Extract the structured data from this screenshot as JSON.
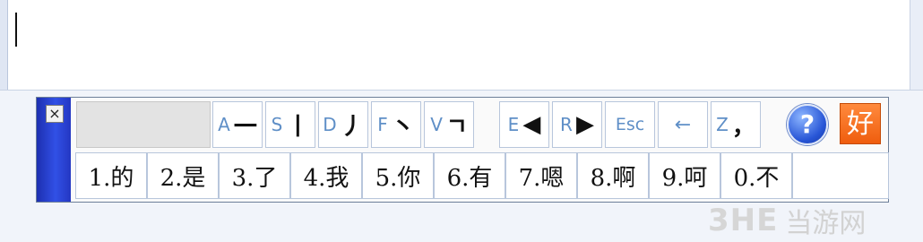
{
  "toolbar": {
    "close_label": "×",
    "pinyin_input": "",
    "keys": [
      {
        "letter": "A",
        "glyph": "一",
        "name": "stroke-key-horizontal"
      },
      {
        "letter": "S",
        "glyph": "丨",
        "name": "stroke-key-vertical"
      },
      {
        "letter": "D",
        "glyph": "丿",
        "name": "stroke-key-left-falling"
      },
      {
        "letter": "F",
        "glyph": "丶",
        "name": "stroke-key-dot"
      },
      {
        "letter": "V",
        "glyph": "ㄱ",
        "name": "stroke-key-turning"
      },
      {
        "letter": "E",
        "glyph": "◀",
        "name": "page-prev-key"
      },
      {
        "letter": "R",
        "glyph": "▶",
        "name": "page-next-key"
      },
      {
        "letter": "",
        "glyph": "Esc",
        "name": "esc-key"
      },
      {
        "letter": "",
        "glyph": "←",
        "name": "backspace-key"
      },
      {
        "letter": "Z",
        "glyph": "，",
        "name": "comma-key"
      }
    ],
    "help_label": "?",
    "logo_label": "好"
  },
  "candidates": [
    "1.的",
    "2.是",
    "3.了",
    "4.我",
    "5.你",
    "6.有",
    "7.嗯",
    "8.啊",
    "9.呵",
    "0.不"
  ],
  "watermark": {
    "logo": "3HE",
    "text": "当游网"
  },
  "colors": {
    "handle": "#2a44d6",
    "key_letter": "#5f8fc7",
    "logo_bg": "#ef5d0e"
  }
}
